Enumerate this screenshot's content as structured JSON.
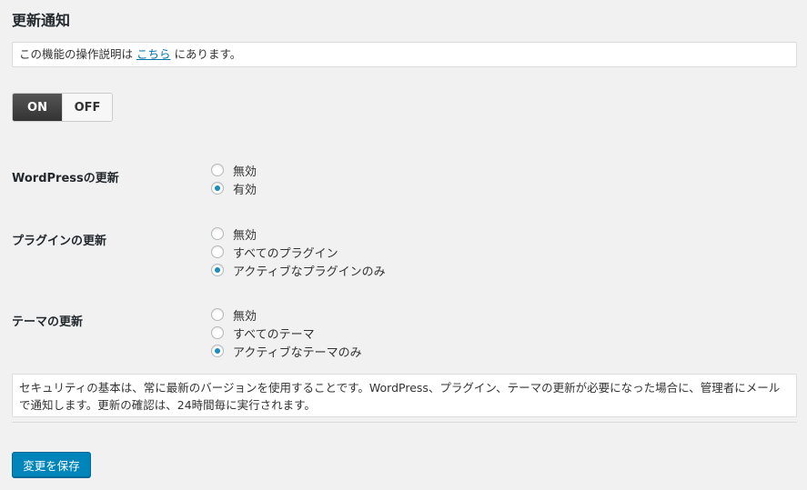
{
  "page": {
    "title": "更新通知"
  },
  "info": {
    "prefix": "この機能の操作説明は ",
    "link": "こちら",
    "suffix": " にあります。"
  },
  "toggle": {
    "on_label": "ON",
    "off_label": "OFF",
    "selected": "ON"
  },
  "settings": [
    {
      "label": "WordPressの更新",
      "options": [
        {
          "label": "無効",
          "checked": false
        },
        {
          "label": "有効",
          "checked": true
        }
      ]
    },
    {
      "label": "プラグインの更新",
      "options": [
        {
          "label": "無効",
          "checked": false
        },
        {
          "label": "すべてのプラグイン",
          "checked": false
        },
        {
          "label": "アクティブなプラグインのみ",
          "checked": true
        }
      ]
    },
    {
      "label": "テーマの更新",
      "options": [
        {
          "label": "無効",
          "checked": false
        },
        {
          "label": "すべてのテーマ",
          "checked": false
        },
        {
          "label": "アクティブなテーマのみ",
          "checked": true
        }
      ]
    }
  ],
  "description": "セキュリティの基本は、常に最新のバージョンを使用することです。WordPress、プラグイン、テーマの更新が必要になった場合に、管理者にメールで通知します。更新の確認は、24時間毎に実行されます。",
  "save_button": "変更を保存",
  "colors": {
    "accent": "#0085ba",
    "radio_checked": "#1e8cbe",
    "link": "#0073aa"
  }
}
